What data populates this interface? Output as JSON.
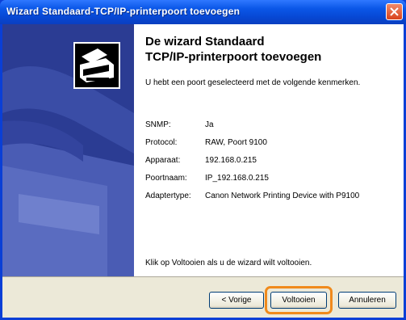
{
  "window": {
    "title": "Wizard Standaard-TCP/IP-printerpoort toevoegen"
  },
  "content": {
    "heading_line1": "De wizard Standaard",
    "heading_line2": "TCP/IP-printerpoort toevoegen",
    "intro": "U hebt een poort geselecteerd met de volgende kenmerken.",
    "details": [
      {
        "label": "SNMP:",
        "value": "Ja"
      },
      {
        "label": "Protocol:",
        "value": "RAW, Poort 9100"
      },
      {
        "label": "Apparaat:",
        "value": "192.168.0.215"
      },
      {
        "label": "Poortnaam:",
        "value": "IP_192.168.0.215"
      },
      {
        "label": "Adaptertype:",
        "value": "Canon Network Printing Device with P9100"
      }
    ],
    "finish_text": "Klik op Voltooien als u de wizard wilt voltooien."
  },
  "buttons": {
    "back": "< Vorige",
    "finish": "Voltooien",
    "cancel": "Annuleren"
  },
  "colors": {
    "side_panel": "#2b3c93",
    "highlight": "#f08a1c"
  },
  "icons": [
    "printer-wizard-icon",
    "close-icon"
  ]
}
